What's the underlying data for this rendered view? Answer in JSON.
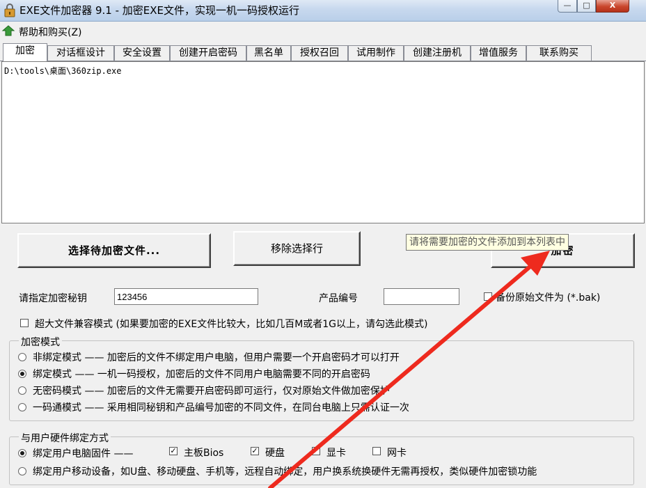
{
  "window": {
    "title": "EXE文件加密器 9.1 - 加密EXE文件，实现一机一码授权运行",
    "min_label": "—",
    "max_label": "□",
    "close_label": "X"
  },
  "menu": {
    "help_buy": "帮助和购买(Z)"
  },
  "tabs": [
    {
      "label": "加密"
    },
    {
      "label": "对话框设计"
    },
    {
      "label": "安全设置"
    },
    {
      "label": "创建开启密码"
    },
    {
      "label": "黑名单"
    },
    {
      "label": "授权召回"
    },
    {
      "label": "试用制作"
    },
    {
      "label": "创建注册机"
    },
    {
      "label": "增值服务"
    },
    {
      "label": "联系购买"
    }
  ],
  "file_list": [
    "D:\\tools\\桌面\\360zip.exe"
  ],
  "buttons": {
    "choose_file": "选择待加密文件...",
    "remove_row": "移除选择行",
    "encrypt": "加密"
  },
  "tooltip": "请将需要加密的文件添加到本列表中",
  "fields": {
    "key_label": "请指定加密秘钥",
    "key_value": "123456",
    "product_label": "产品编号",
    "product_value": "",
    "backup_label": "备份原始文件为 (*.bak)",
    "backup_checked": false
  },
  "large_file": {
    "label": "超大文件兼容模式 (如果要加密的EXE文件比较大，比如几百M或者1G以上，请勾选此模式)",
    "checked": false
  },
  "encrypt_mode": {
    "title": "加密模式",
    "selected_index": 1,
    "options": [
      "非绑定模式 —— 加密后的文件不绑定用户电脑，但用户需要一个开启密码才可以打开",
      "绑定模式 —— 一机一码授权，加密后的文件不同用户电脑需要不同的开启密码",
      "无密码模式 —— 加密后的文件无需要开启密码即可运行，仅对原始文件做加密保护",
      "一码通模式 —— 采用相同秘钥和产品编号加密的不同文件，在同台电脑上只需认证一次"
    ]
  },
  "hw_binding": {
    "title": "与用户硬件绑定方式",
    "option_pc": "绑定用户电脑固件 ——",
    "option_pc_selected": true,
    "components": [
      {
        "label": "主板Bios",
        "checked": true
      },
      {
        "label": "硬盘",
        "checked": true
      },
      {
        "label": "显卡",
        "checked": true
      },
      {
        "label": "网卡",
        "checked": false
      }
    ],
    "option_mobile": "绑定用户移动设备，如U盘、移动硬盘、手机等，远程自动绑定，用户换系统换硬件无需再授权，类似硬件加密锁功能",
    "option_mobile_selected": false
  },
  "colors": {
    "annotation_arrow": "#ee2a1e",
    "title_bar": "#c7d8ee",
    "close_button": "#c9462c"
  },
  "icons": [
    "app-lock-icon",
    "help-icon"
  ]
}
